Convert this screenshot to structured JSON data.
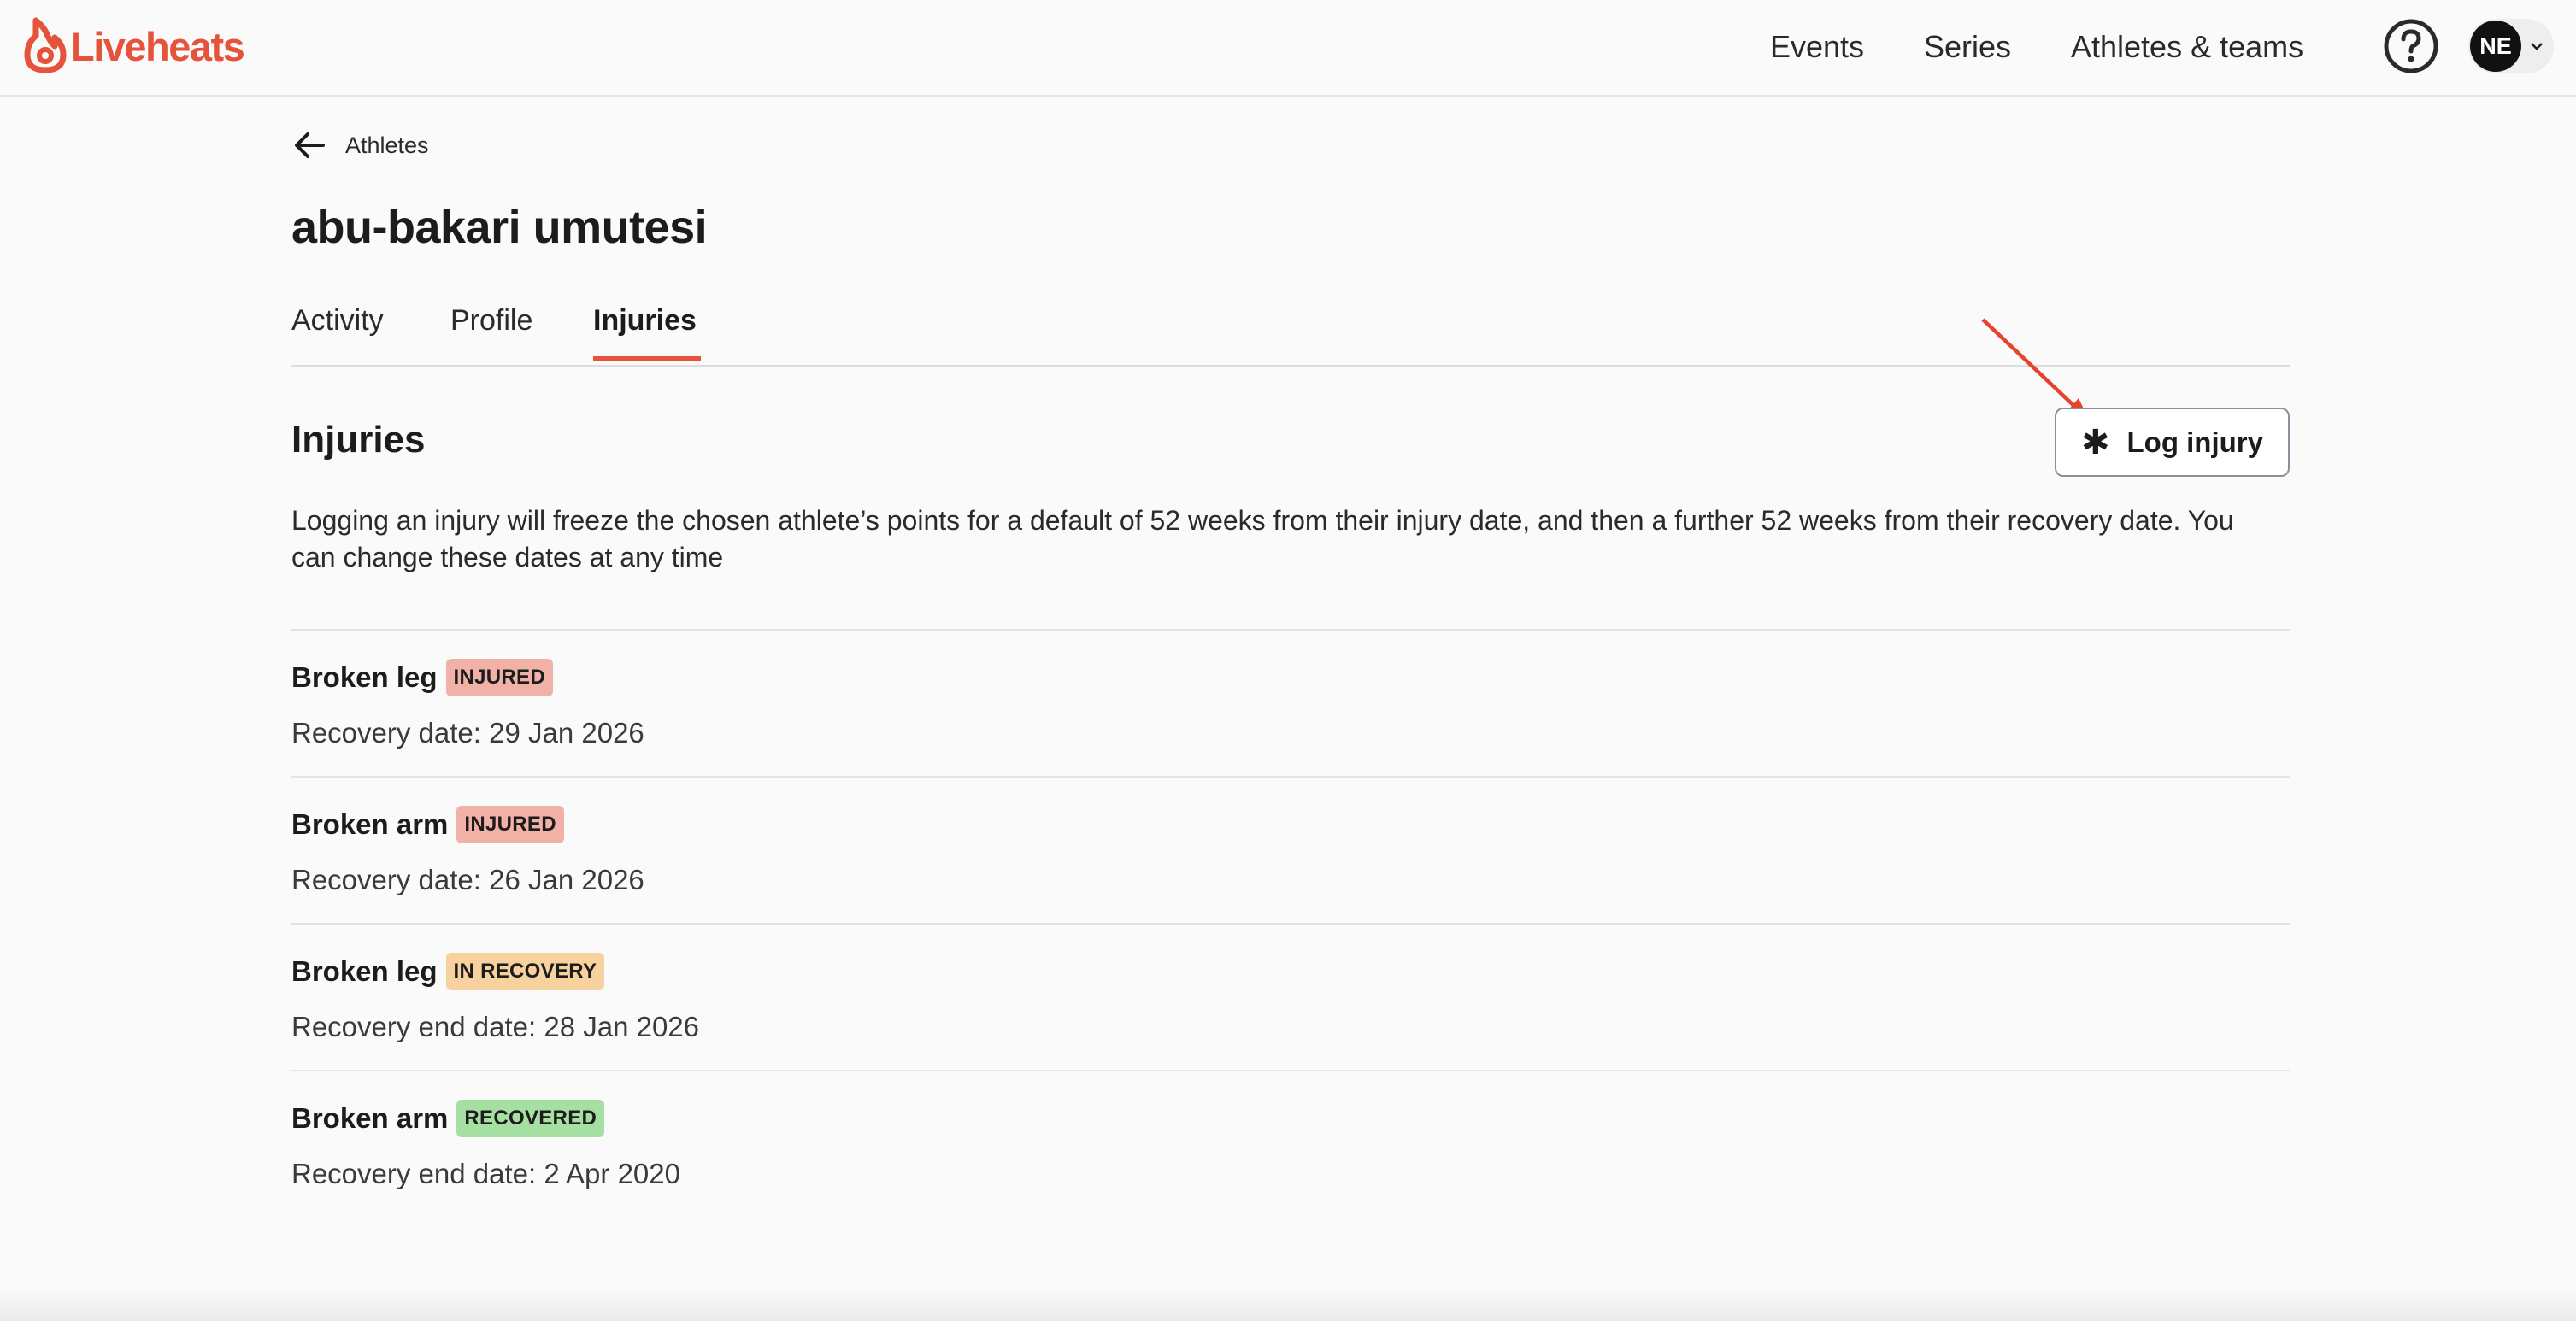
{
  "header": {
    "brand": "Liveheats",
    "nav": [
      "Events",
      "Series",
      "Athletes & teams"
    ],
    "avatar_initials": "NE",
    "brand_color": "#e4533a"
  },
  "breadcrumb": {
    "label": "Athletes"
  },
  "page": {
    "title": "abu-bakari umutesi"
  },
  "tabs": [
    {
      "label": "Activity",
      "active": false
    },
    {
      "label": "Profile",
      "active": false
    },
    {
      "label": "Injuries",
      "active": true
    }
  ],
  "injuries": {
    "title": "Injuries",
    "log_button": "Log injury",
    "description": "Logging an injury will freeze the chosen athlete’s points for a default of 52 weeks from their injury date, and then a further 52 weeks from their recovery date. You can change these dates at any time",
    "items": [
      {
        "name": "Broken leg",
        "status": "INJURED",
        "status_color": "#f2b1a6",
        "detail": "Recovery date: 29 Jan 2026"
      },
      {
        "name": "Broken arm",
        "status": "INJURED",
        "status_color": "#f2b1a6",
        "detail": "Recovery date: 26 Jan 2026"
      },
      {
        "name": "Broken leg",
        "status": "IN RECOVERY",
        "status_color": "#f7d19e",
        "detail": "Recovery end date: 28 Jan 2026"
      },
      {
        "name": "Broken arm",
        "status": "RECOVERED",
        "status_color": "#a6dfa2",
        "detail": "Recovery end date: 2 Apr 2020"
      }
    ]
  }
}
